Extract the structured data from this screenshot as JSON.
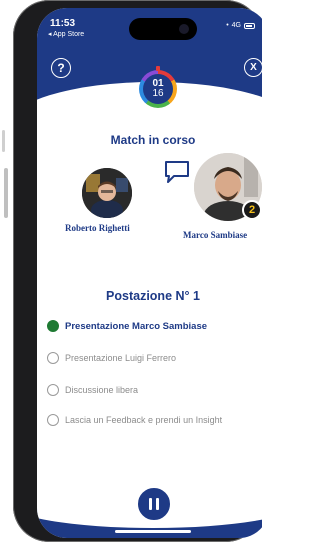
{
  "status": {
    "time": "11:53",
    "back_label": "◂ App Store",
    "network": "4G"
  },
  "header": {
    "help_icon": "?",
    "close_icon": "X"
  },
  "timer": {
    "minutes": "01",
    "seconds": "16"
  },
  "match": {
    "title": "Match in corso"
  },
  "participants": {
    "left_name": "Roberto Righetti",
    "right_name": "Marco Sambiase",
    "right_badge": "2"
  },
  "station": {
    "title": "Postazione N° 1"
  },
  "steps": [
    {
      "label": "Presentazione Marco Sambiase",
      "active": true
    },
    {
      "label": "Presentazione Luigi Ferrero",
      "active": false
    },
    {
      "label": "Discussione libera",
      "active": false
    },
    {
      "label": "Lascia un Feedback e prendi un Insight",
      "active": false
    }
  ],
  "icons": {
    "help": "question-circle-icon",
    "close": "close-circle-icon",
    "chat": "chat-bubble-icon",
    "pause": "pause-icon"
  },
  "colors": {
    "primary": "#1e3a86",
    "active_step": "#1f7a33",
    "inactive_step": "#8c8c8c"
  }
}
